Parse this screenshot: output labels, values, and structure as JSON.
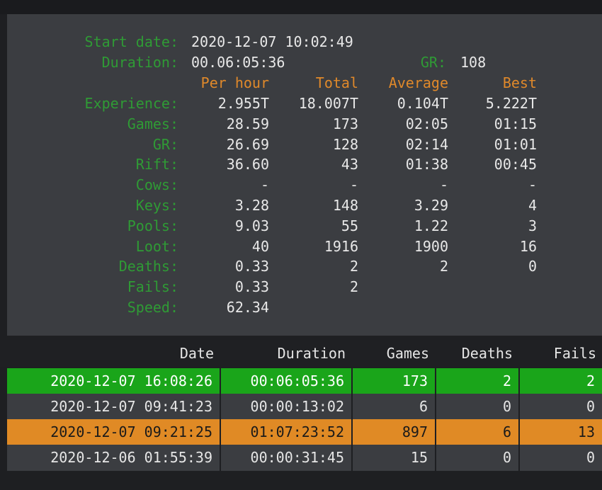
{
  "summary": {
    "start_date_label": "Start date:",
    "start_date_value": "2020-12-07 10:02:49",
    "duration_label": "Duration:",
    "duration_value": "00.06:05:36",
    "gr_label": "GR:",
    "gr_value": "108",
    "columns": [
      "Per hour",
      "Total",
      "Average",
      "Best"
    ],
    "rows": [
      {
        "label": "Experience:",
        "per_hour": "2.955T",
        "total": "18.007T",
        "average": "0.104T",
        "best": "5.222T"
      },
      {
        "label": "Games:",
        "per_hour": "28.59",
        "total": "173",
        "average": "02:05",
        "best": "01:15"
      },
      {
        "label": "GR:",
        "per_hour": "26.69",
        "total": "128",
        "average": "02:14",
        "best": "01:01"
      },
      {
        "label": "Rift:",
        "per_hour": "36.60",
        "total": "43",
        "average": "01:38",
        "best": "00:45"
      },
      {
        "label": "Cows:",
        "per_hour": "-",
        "total": "-",
        "average": "-",
        "best": "-"
      },
      {
        "label": "Keys:",
        "per_hour": "3.28",
        "total": "148",
        "average": "3.29",
        "best": "4"
      },
      {
        "label": "Pools:",
        "per_hour": "9.03",
        "total": "55",
        "average": "1.22",
        "best": "3"
      },
      {
        "label": "Loot:",
        "per_hour": "40",
        "total": "1916",
        "average": "1900",
        "best": "16"
      },
      {
        "label": "Deaths:",
        "per_hour": "0.33",
        "total": "2",
        "average": "2",
        "best": "0"
      },
      {
        "label": "Fails:",
        "per_hour": "0.33",
        "total": "2",
        "average": "",
        "best": ""
      },
      {
        "label": "Speed:",
        "per_hour": "62.34",
        "total": "",
        "average": "",
        "best": ""
      }
    ]
  },
  "sessions": {
    "headers": [
      "Date",
      "Duration",
      "Games",
      "Deaths",
      "Fails"
    ],
    "rows": [
      {
        "date": "2020-12-07 16:08:26",
        "duration": "00:06:05:36",
        "games": "173",
        "deaths": "2",
        "fails": "2",
        "style": "green"
      },
      {
        "date": "2020-12-07 09:41:23",
        "duration": "00:00:13:02",
        "games": "6",
        "deaths": "0",
        "fails": "0",
        "style": "gray"
      },
      {
        "date": "2020-12-07 09:21:25",
        "duration": "01:07:23:52",
        "games": "897",
        "deaths": "6",
        "fails": "13",
        "style": "orange"
      },
      {
        "date": "2020-12-06 01:55:39",
        "duration": "00:00:31:45",
        "games": "15",
        "deaths": "0",
        "fails": "0",
        "style": "gray"
      }
    ]
  },
  "colors": {
    "label_green": "#2f9b35",
    "header_orange": "#e0892a",
    "row_green": "#1aa51a",
    "row_orange": "#e08a25",
    "row_gray": "#3b3d41"
  }
}
